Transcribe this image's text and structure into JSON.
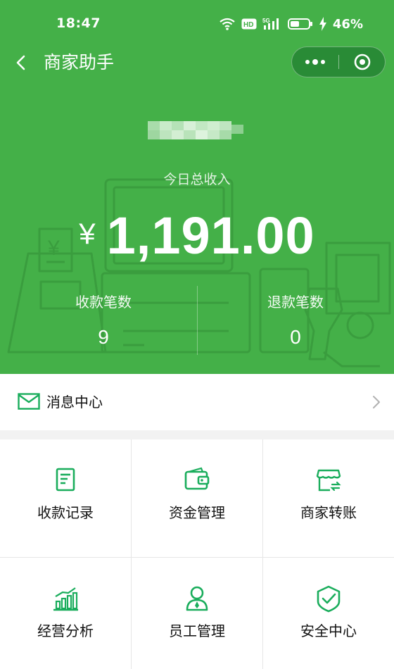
{
  "status_bar": {
    "time": "18:47",
    "battery_percent": "46%",
    "icons": [
      "wifi-icon",
      "hd-icon",
      "5g-signal-icon",
      "battery-icon",
      "charging-icon"
    ]
  },
  "nav": {
    "title": "商家助手",
    "back_icon": "chevron-left-icon",
    "capsule_more_icon": "more-dots-icon",
    "capsule_close_icon": "target-close-icon"
  },
  "summary": {
    "income_label": "今日总收入",
    "currency_symbol": "¥",
    "income_amount": "1,191.00",
    "stats": [
      {
        "label": "收款笔数",
        "value": "9"
      },
      {
        "label": "退款笔数",
        "value": "0"
      }
    ]
  },
  "message_center": {
    "label": "消息中心",
    "icon": "envelope-icon"
  },
  "menu": [
    {
      "label": "收款记录",
      "icon": "receipt-record-icon"
    },
    {
      "label": "资金管理",
      "icon": "wallet-icon"
    },
    {
      "label": "商家转账",
      "icon": "store-transfer-icon"
    },
    {
      "label": "经营分析",
      "icon": "bar-chart-icon"
    },
    {
      "label": "员工管理",
      "icon": "staff-icon"
    },
    {
      "label": "安全中心",
      "icon": "shield-check-icon"
    }
  ],
  "colors": {
    "brand_green": "#44b048",
    "icon_green": "#1aad5c",
    "header_bg": "#44b048",
    "page_bg": "#f2f2f2"
  }
}
